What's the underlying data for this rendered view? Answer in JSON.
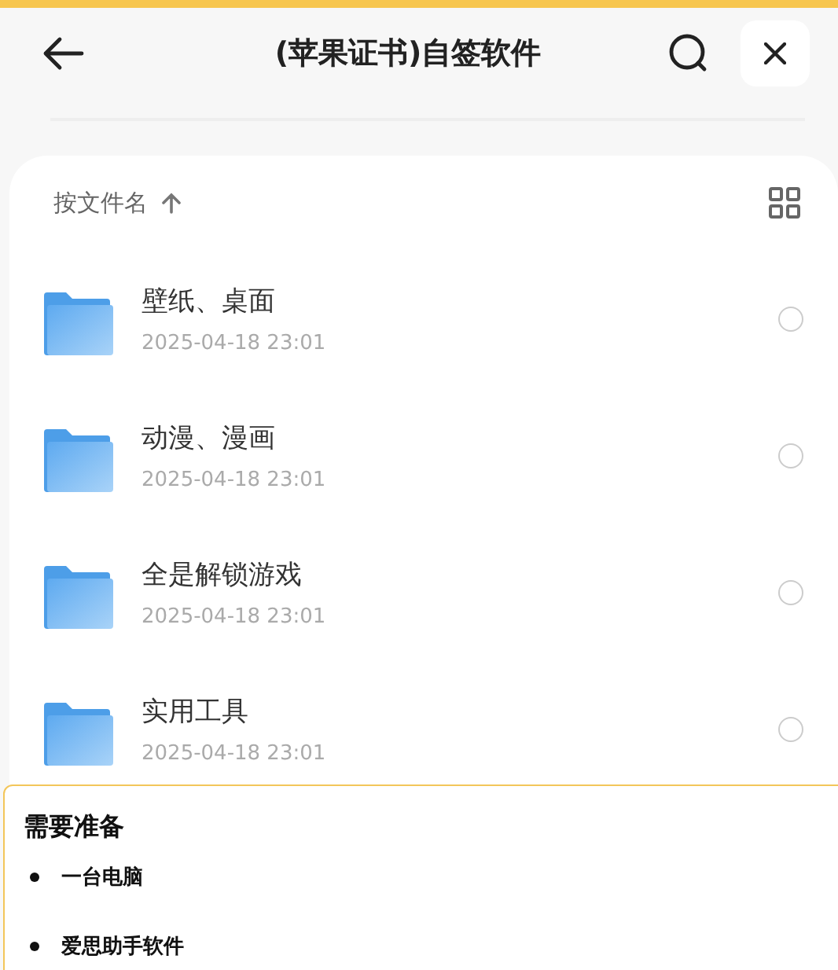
{
  "header": {
    "title": "(苹果证书)自签软件"
  },
  "sort": {
    "label": "按文件名"
  },
  "files": [
    {
      "name": "壁纸、桌面",
      "date": "2025-04-18 23:01",
      "selected": false
    },
    {
      "name": "动漫、漫画",
      "date": "2025-04-18 23:01",
      "selected": false
    },
    {
      "name": "全是解锁游戏",
      "date": "2025-04-18 23:01",
      "selected": false
    },
    {
      "name": "实用工具",
      "date": "2025-04-18 23:01",
      "selected": false
    }
  ],
  "notice": {
    "title": "需要准备",
    "items": [
      "一台电脑",
      "爱思助手软件"
    ]
  }
}
